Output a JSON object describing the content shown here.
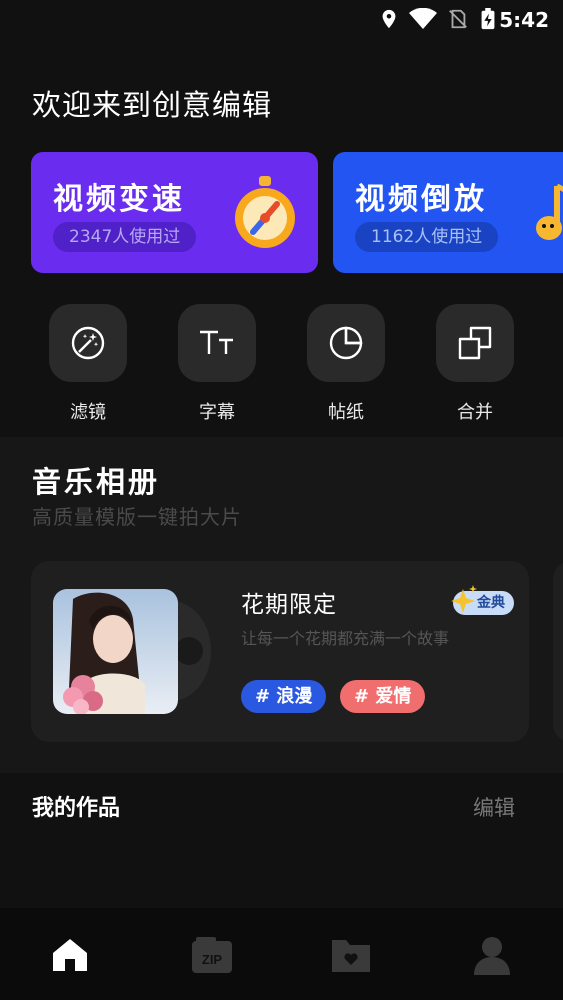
{
  "status_bar": {
    "time": "5:42",
    "icons": [
      "location-icon",
      "wifi-icon",
      "no-sim-icon",
      "battery-charging-icon"
    ]
  },
  "welcome_text": "欢迎来到创意编辑",
  "feature_cards": [
    {
      "title": "视频变速",
      "usage": "2347人使用过",
      "art": "stopwatch-icon",
      "color": "#6a2df0"
    },
    {
      "title": "视频倒放",
      "usage": "1162人使用过",
      "art": "music-note-icon",
      "color": "#2255f2"
    }
  ],
  "tools": [
    {
      "label": "滤镜",
      "icon": "filter-magic-icon"
    },
    {
      "label": "字幕",
      "icon": "text-size-icon"
    },
    {
      "label": "帖纸",
      "icon": "sticker-icon"
    },
    {
      "label": "合并",
      "icon": "merge-icon"
    }
  ],
  "music_album": {
    "title": "音乐相册",
    "subtitle": "高质量模版一键拍大片",
    "card": {
      "name": "花期限定",
      "description": "让每一个花期都充满一个故事",
      "badge": "金典",
      "tags": [
        "# 浪漫",
        "# 爱情"
      ]
    }
  },
  "my_works": {
    "title": "我的作品",
    "edit_label": "编辑"
  },
  "bottom_nav": [
    {
      "name": "home",
      "icon": "home-icon",
      "active": true
    },
    {
      "name": "zip",
      "icon": "zip-icon",
      "active": false
    },
    {
      "name": "folder",
      "icon": "folder-heart-icon",
      "active": false
    },
    {
      "name": "profile",
      "icon": "user-icon",
      "active": false
    }
  ],
  "colors": {
    "background": "#111111",
    "card_purple": "#6a2df0",
    "card_blue": "#2255f2",
    "tag_blue": "#2b58e0",
    "tag_red": "#f06e6e"
  }
}
